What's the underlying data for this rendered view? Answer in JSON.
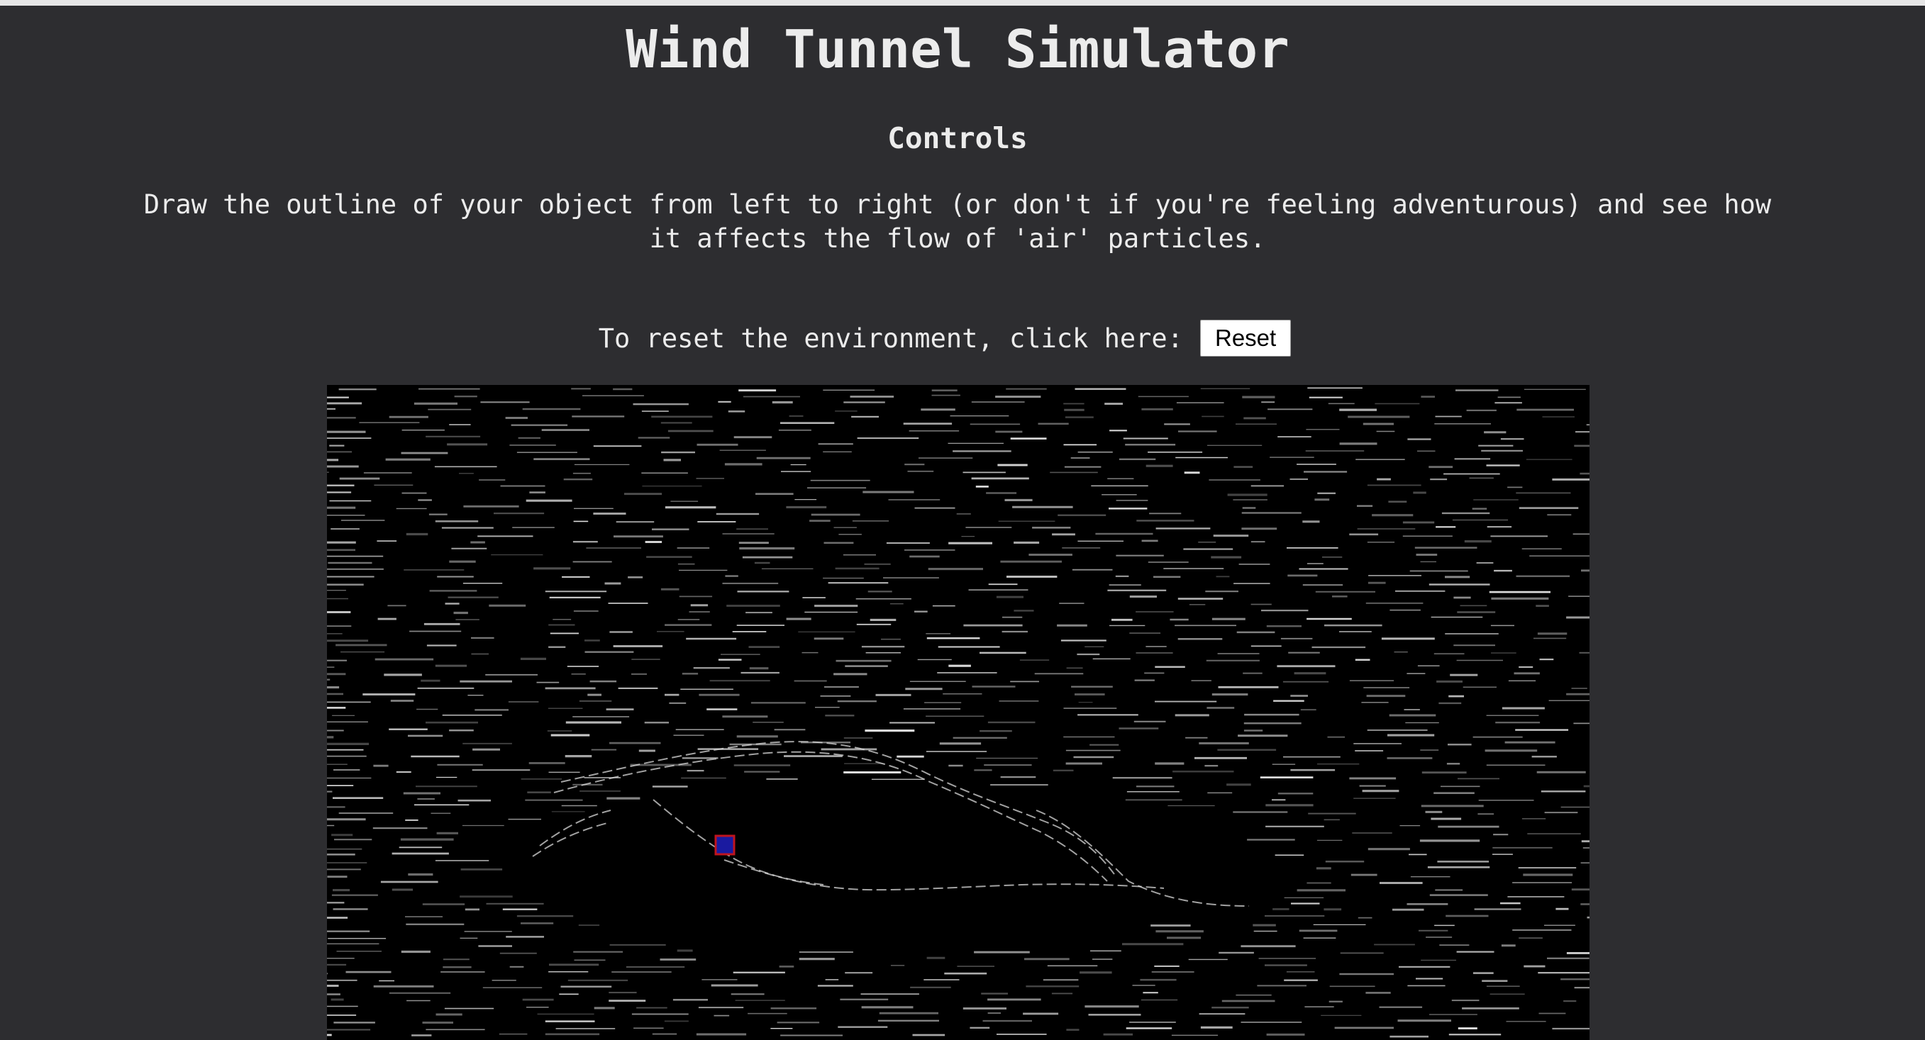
{
  "page": {
    "title": "Wind Tunnel Simulator",
    "controls_heading": "Controls",
    "description": "Draw the outline of your object from left to right (or don't if you're feeling adventurous) and see how it affects the flow of 'air' particles.",
    "reset_label": "To reset the environment, click here:",
    "reset_button": "Reset"
  },
  "colors": {
    "background": "#2d2d30",
    "canvas": "#000000",
    "particle": "#e0e0e0",
    "cursor_fill": "#1a1aa0",
    "cursor_border": "#c0141e"
  }
}
